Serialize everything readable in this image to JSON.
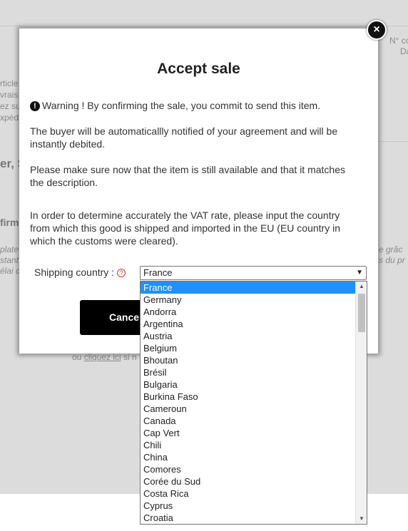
{
  "background": {
    "top_right_1": "N° co",
    "top_right_2": "Da",
    "left_1": "rticle",
    "left_2": "vrais",
    "left_3": "ez sur",
    "left_4": "xpédi",
    "heading_1": "er, S",
    "heading_2": "firma",
    "italic_left_1": "plate",
    "italic_left_2": "stant",
    "italic_left_3": "élai c",
    "italic_right_1": "e grâc",
    "italic_right_2": "s du pr",
    "footer_prefix": "ou ",
    "footer_link": "cliquez ici",
    "footer_suffix": " si n"
  },
  "modal": {
    "title": "Accept sale",
    "warning": "Warning ! By confirming the sale, you commit to send this item.",
    "para_notified": "The buyer will be automaticallly notified of your agreement and will be instantly debited.",
    "para_available": "Please make sure now that the item is still available and that it matches the description.",
    "para_vat": "In order to determine accurately the VAT rate, please input the country from which this good is shipped and imported in the EU (EU country in which the customs were cleared).",
    "shipping_label": "Shipping country :",
    "help_glyph": "?",
    "selected_country": "France",
    "cancel_label": "Cancel",
    "close_glyph": "×",
    "warn_glyph": "!"
  },
  "dropdown": {
    "options": [
      "France",
      "Germany",
      "Andorra",
      "Argentina",
      "Austria",
      "Belgium",
      "Bhoutan",
      "Brésil",
      "Bulgaria",
      "Burkina Faso",
      "Cameroun",
      "Canada",
      "Cap Vert",
      "Chili",
      "China",
      "Comores",
      "Corée du Sud",
      "Costa Rica",
      "Cyprus",
      "Croatia"
    ],
    "selected_index": 0,
    "arrow_up": "▲",
    "arrow_down": "▼"
  },
  "colors": {
    "selected_option_bg": "#1e90ff",
    "cancel_bg": "#000000",
    "overlay_bg": "#dcdcdc"
  }
}
